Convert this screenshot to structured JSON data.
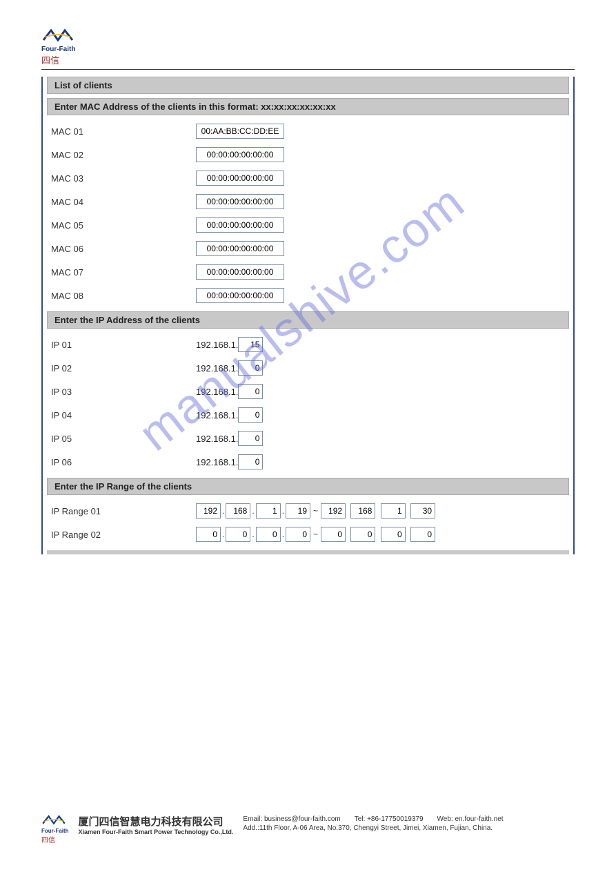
{
  "brand": {
    "name": "Four-Faith",
    "cjk": "四信"
  },
  "watermark": "manualshive.com",
  "sections": {
    "list_title": "List of clients",
    "mac_title": "Enter MAC Address of the clients in this format: xx:xx:xx:xx:xx:xx",
    "ip_title": "Enter the IP Address of the clients",
    "range_title": "Enter the IP Range of the clients"
  },
  "mac": [
    {
      "label": "MAC 01",
      "value": "00:AA:BB:CC:DD:EE"
    },
    {
      "label": "MAC 02",
      "value": "00:00:00:00:00:00"
    },
    {
      "label": "MAC 03",
      "value": "00:00:00:00:00:00"
    },
    {
      "label": "MAC 04",
      "value": "00:00:00:00:00:00"
    },
    {
      "label": "MAC 05",
      "value": "00:00:00:00:00:00"
    },
    {
      "label": "MAC 06",
      "value": "00:00:00:00:00:00"
    },
    {
      "label": "MAC 07",
      "value": "00:00:00:00:00:00"
    },
    {
      "label": "MAC 08",
      "value": "00:00:00:00:00:00"
    }
  ],
  "ip_prefix": "192.168.1.",
  "ip": [
    {
      "label": "IP 01",
      "value": "15"
    },
    {
      "label": "IP 02",
      "value": "0"
    },
    {
      "label": "IP 03",
      "value": "0"
    },
    {
      "label": "IP 04",
      "value": "0"
    },
    {
      "label": "IP 05",
      "value": "0"
    },
    {
      "label": "IP 06",
      "value": "0"
    }
  ],
  "ranges": [
    {
      "label": "IP Range 01",
      "from": [
        "192",
        "168",
        "1",
        "19"
      ],
      "to": [
        "192",
        "168",
        "1",
        "30"
      ]
    },
    {
      "label": "IP Range 02",
      "from": [
        "0",
        "0",
        "0",
        "0"
      ],
      "to": [
        "0",
        "0",
        "0",
        "0"
      ]
    }
  ],
  "footer": {
    "company_cn": "厦门四信智慧电力科技有限公司",
    "company_en": "Xiamen Four-Faith Smart Power Technology Co.,Ltd.",
    "email_lbl": "Email: business@four-faith.com",
    "tel_lbl": "Tel: +86-17750019379",
    "web_lbl": "Web: en.four-faith.net",
    "addr": "Add.:11th Floor, A-06 Area, No.370, Chengyi Street, Jimei, Xiamen, Fujian, China."
  }
}
